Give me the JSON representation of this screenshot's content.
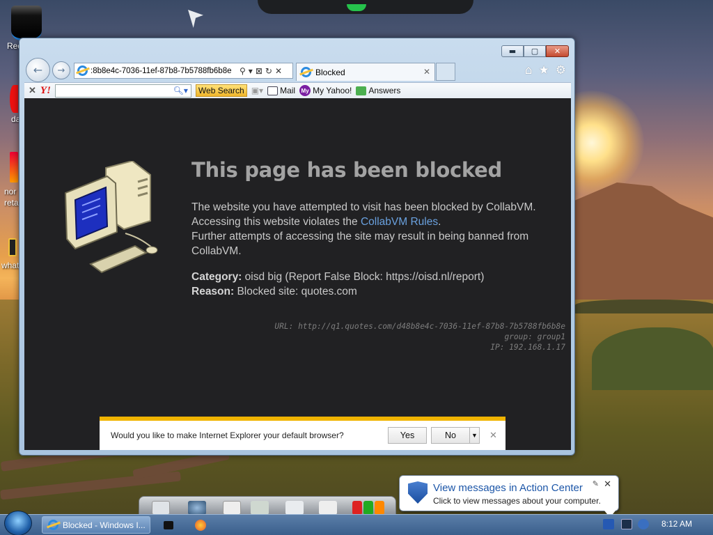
{
  "desktop": {
    "icon_labels": [
      "Red",
      "da",
      "nor",
      "reta",
      "what"
    ]
  },
  "browser": {
    "address_url": ":8b8e4c-7036-11ef-87b8-7b5788fb6b8e",
    "tab_title": "Blocked",
    "toolbar": {
      "web_search_label": "Web Search",
      "mail_label": "Mail",
      "my_yahoo_label": "My Yahoo!",
      "answers_label": "Answers"
    }
  },
  "page": {
    "heading": "This page has been blocked",
    "intro_line1": "The website you have attempted to visit has been blocked by CollabVM.",
    "intro_line2_prefix": "Accessing this website violates the ",
    "intro_link": "CollabVM Rules",
    "intro_line2_suffix": ".",
    "intro_line3": "Further attempts of accessing the site may result in being banned from CollabVM.",
    "category_label": "Category:",
    "category_value": "oisd big (Report False Block: https://oisd.nl/report)",
    "reason_label": "Reason:",
    "reason_value": "Blocked site: quotes.com",
    "meta_url": "URL: http://q1.quotes.com/d48b8e4c-7036-11ef-87b8-7b5788fb6b8e",
    "meta_group": "group: group1",
    "meta_ip": "IP: 192.168.1.17"
  },
  "notification": {
    "message": "Would you like to make Internet Explorer your default browser?",
    "yes_label": "Yes",
    "no_label": "No"
  },
  "taskbar": {
    "active_task": "Blocked - Windows I...",
    "clock": "8:12 AM"
  },
  "balloon": {
    "title": "View messages in Action Center",
    "body": "Click to view messages about your computer."
  },
  "colors": {
    "page_bg": "#212123",
    "link": "#6aa1df",
    "notification_bar": "#f0b400"
  }
}
